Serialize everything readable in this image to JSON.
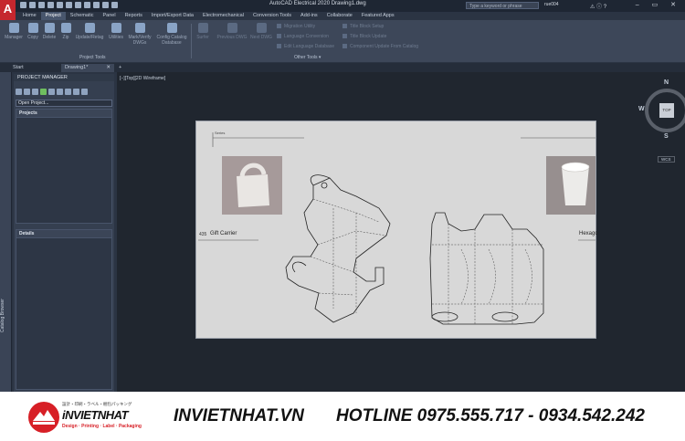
{
  "app": {
    "logo_letter": "A",
    "title": "AutoCAD Electrical 2020   Drawing1.dwg",
    "search_placeholder": "Type a keyword or phrase",
    "user": "rue004",
    "window_controls": "– ▭ ✕"
  },
  "menu": [
    {
      "label": "Home"
    },
    {
      "label": "Project"
    },
    {
      "label": "Schematic"
    },
    {
      "label": "Panel"
    },
    {
      "label": "Reports"
    },
    {
      "label": "Import/Export Data"
    },
    {
      "label": "Electromechanical"
    },
    {
      "label": "Conversion Tools"
    },
    {
      "label": "Add-ins"
    },
    {
      "label": "Collaborate"
    },
    {
      "label": "Featured Apps"
    }
  ],
  "ribbon": {
    "buttons": [
      {
        "label": "Manager"
      },
      {
        "label": "Copy"
      },
      {
        "label": "Delete"
      },
      {
        "label": "Zip"
      },
      {
        "label": "Update/Retag"
      },
      {
        "label": "Utilities"
      },
      {
        "label": "Mark/Verify DWGs"
      },
      {
        "label": "Config Catalog Database"
      },
      {
        "label": "Surfer"
      },
      {
        "label": "Previous DWG"
      },
      {
        "label": "Next DWG"
      }
    ],
    "small_items": [
      {
        "label": "Migration Utility"
      },
      {
        "label": "Language Conversion"
      },
      {
        "label": "Edit Language Database"
      },
      {
        "label": "Title Block Setup"
      },
      {
        "label": "Title Block Update"
      },
      {
        "label": "Component Update From Catalog"
      }
    ],
    "panel_project_tools": "Project Tools",
    "panel_other_tools": "Other Tools ▾"
  },
  "doctabs": {
    "start": "Start",
    "drawing": "Drawing1*",
    "close": "✕",
    "add": "+"
  },
  "sidebar": {
    "catalog_browser": "Catalog Browser"
  },
  "project_manager": {
    "title": "PROJECT MANAGER",
    "open_project": "Open Project...",
    "projects_header": "Projects",
    "details_header": "Details"
  },
  "viewport": {
    "label": "[−][Top][2D Wireframe]",
    "cube_top": "TOP",
    "compass_n": "N",
    "compass_s": "S",
    "compass_w": "W",
    "wcs": "WCS"
  },
  "drawing": {
    "label_left": "Gift Carrier",
    "label_left_num": "435",
    "label_right": "Hexago",
    "header_text": "Series"
  },
  "footer": {
    "brand_top": "Design · Printing · Label · Packaging",
    "brand_name": "iNVIETNHAT",
    "site": "INVIETNHAT.VN",
    "hotline": "HOTLINE 0975.555.717 - 0934.542.242"
  }
}
